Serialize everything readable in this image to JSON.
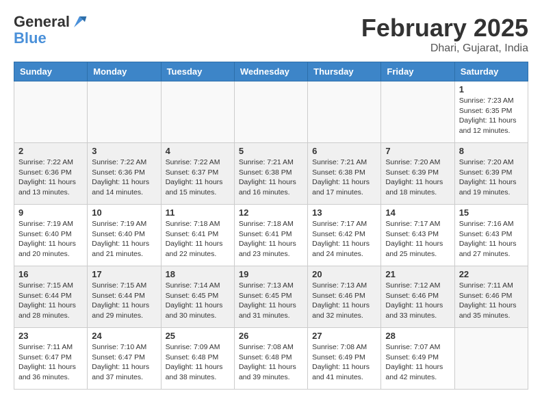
{
  "header": {
    "logo_general": "General",
    "logo_blue": "Blue",
    "month_title": "February 2025",
    "location": "Dhari, Gujarat, India"
  },
  "weekdays": [
    "Sunday",
    "Monday",
    "Tuesday",
    "Wednesday",
    "Thursday",
    "Friday",
    "Saturday"
  ],
  "weeks": [
    [
      {
        "day": "",
        "info": ""
      },
      {
        "day": "",
        "info": ""
      },
      {
        "day": "",
        "info": ""
      },
      {
        "day": "",
        "info": ""
      },
      {
        "day": "",
        "info": ""
      },
      {
        "day": "",
        "info": ""
      },
      {
        "day": "1",
        "info": "Sunrise: 7:23 AM\nSunset: 6:35 PM\nDaylight: 11 hours and 12 minutes."
      }
    ],
    [
      {
        "day": "2",
        "info": "Sunrise: 7:22 AM\nSunset: 6:36 PM\nDaylight: 11 hours and 13 minutes."
      },
      {
        "day": "3",
        "info": "Sunrise: 7:22 AM\nSunset: 6:36 PM\nDaylight: 11 hours and 14 minutes."
      },
      {
        "day": "4",
        "info": "Sunrise: 7:22 AM\nSunset: 6:37 PM\nDaylight: 11 hours and 15 minutes."
      },
      {
        "day": "5",
        "info": "Sunrise: 7:21 AM\nSunset: 6:38 PM\nDaylight: 11 hours and 16 minutes."
      },
      {
        "day": "6",
        "info": "Sunrise: 7:21 AM\nSunset: 6:38 PM\nDaylight: 11 hours and 17 minutes."
      },
      {
        "day": "7",
        "info": "Sunrise: 7:20 AM\nSunset: 6:39 PM\nDaylight: 11 hours and 18 minutes."
      },
      {
        "day": "8",
        "info": "Sunrise: 7:20 AM\nSunset: 6:39 PM\nDaylight: 11 hours and 19 minutes."
      }
    ],
    [
      {
        "day": "9",
        "info": "Sunrise: 7:19 AM\nSunset: 6:40 PM\nDaylight: 11 hours and 20 minutes."
      },
      {
        "day": "10",
        "info": "Sunrise: 7:19 AM\nSunset: 6:40 PM\nDaylight: 11 hours and 21 minutes."
      },
      {
        "day": "11",
        "info": "Sunrise: 7:18 AM\nSunset: 6:41 PM\nDaylight: 11 hours and 22 minutes."
      },
      {
        "day": "12",
        "info": "Sunrise: 7:18 AM\nSunset: 6:41 PM\nDaylight: 11 hours and 23 minutes."
      },
      {
        "day": "13",
        "info": "Sunrise: 7:17 AM\nSunset: 6:42 PM\nDaylight: 11 hours and 24 minutes."
      },
      {
        "day": "14",
        "info": "Sunrise: 7:17 AM\nSunset: 6:43 PM\nDaylight: 11 hours and 25 minutes."
      },
      {
        "day": "15",
        "info": "Sunrise: 7:16 AM\nSunset: 6:43 PM\nDaylight: 11 hours and 27 minutes."
      }
    ],
    [
      {
        "day": "16",
        "info": "Sunrise: 7:15 AM\nSunset: 6:44 PM\nDaylight: 11 hours and 28 minutes."
      },
      {
        "day": "17",
        "info": "Sunrise: 7:15 AM\nSunset: 6:44 PM\nDaylight: 11 hours and 29 minutes."
      },
      {
        "day": "18",
        "info": "Sunrise: 7:14 AM\nSunset: 6:45 PM\nDaylight: 11 hours and 30 minutes."
      },
      {
        "day": "19",
        "info": "Sunrise: 7:13 AM\nSunset: 6:45 PM\nDaylight: 11 hours and 31 minutes."
      },
      {
        "day": "20",
        "info": "Sunrise: 7:13 AM\nSunset: 6:46 PM\nDaylight: 11 hours and 32 minutes."
      },
      {
        "day": "21",
        "info": "Sunrise: 7:12 AM\nSunset: 6:46 PM\nDaylight: 11 hours and 33 minutes."
      },
      {
        "day": "22",
        "info": "Sunrise: 7:11 AM\nSunset: 6:46 PM\nDaylight: 11 hours and 35 minutes."
      }
    ],
    [
      {
        "day": "23",
        "info": "Sunrise: 7:11 AM\nSunset: 6:47 PM\nDaylight: 11 hours and 36 minutes."
      },
      {
        "day": "24",
        "info": "Sunrise: 7:10 AM\nSunset: 6:47 PM\nDaylight: 11 hours and 37 minutes."
      },
      {
        "day": "25",
        "info": "Sunrise: 7:09 AM\nSunset: 6:48 PM\nDaylight: 11 hours and 38 minutes."
      },
      {
        "day": "26",
        "info": "Sunrise: 7:08 AM\nSunset: 6:48 PM\nDaylight: 11 hours and 39 minutes."
      },
      {
        "day": "27",
        "info": "Sunrise: 7:08 AM\nSunset: 6:49 PM\nDaylight: 11 hours and 41 minutes."
      },
      {
        "day": "28",
        "info": "Sunrise: 7:07 AM\nSunset: 6:49 PM\nDaylight: 11 hours and 42 minutes."
      },
      {
        "day": "",
        "info": ""
      }
    ]
  ]
}
